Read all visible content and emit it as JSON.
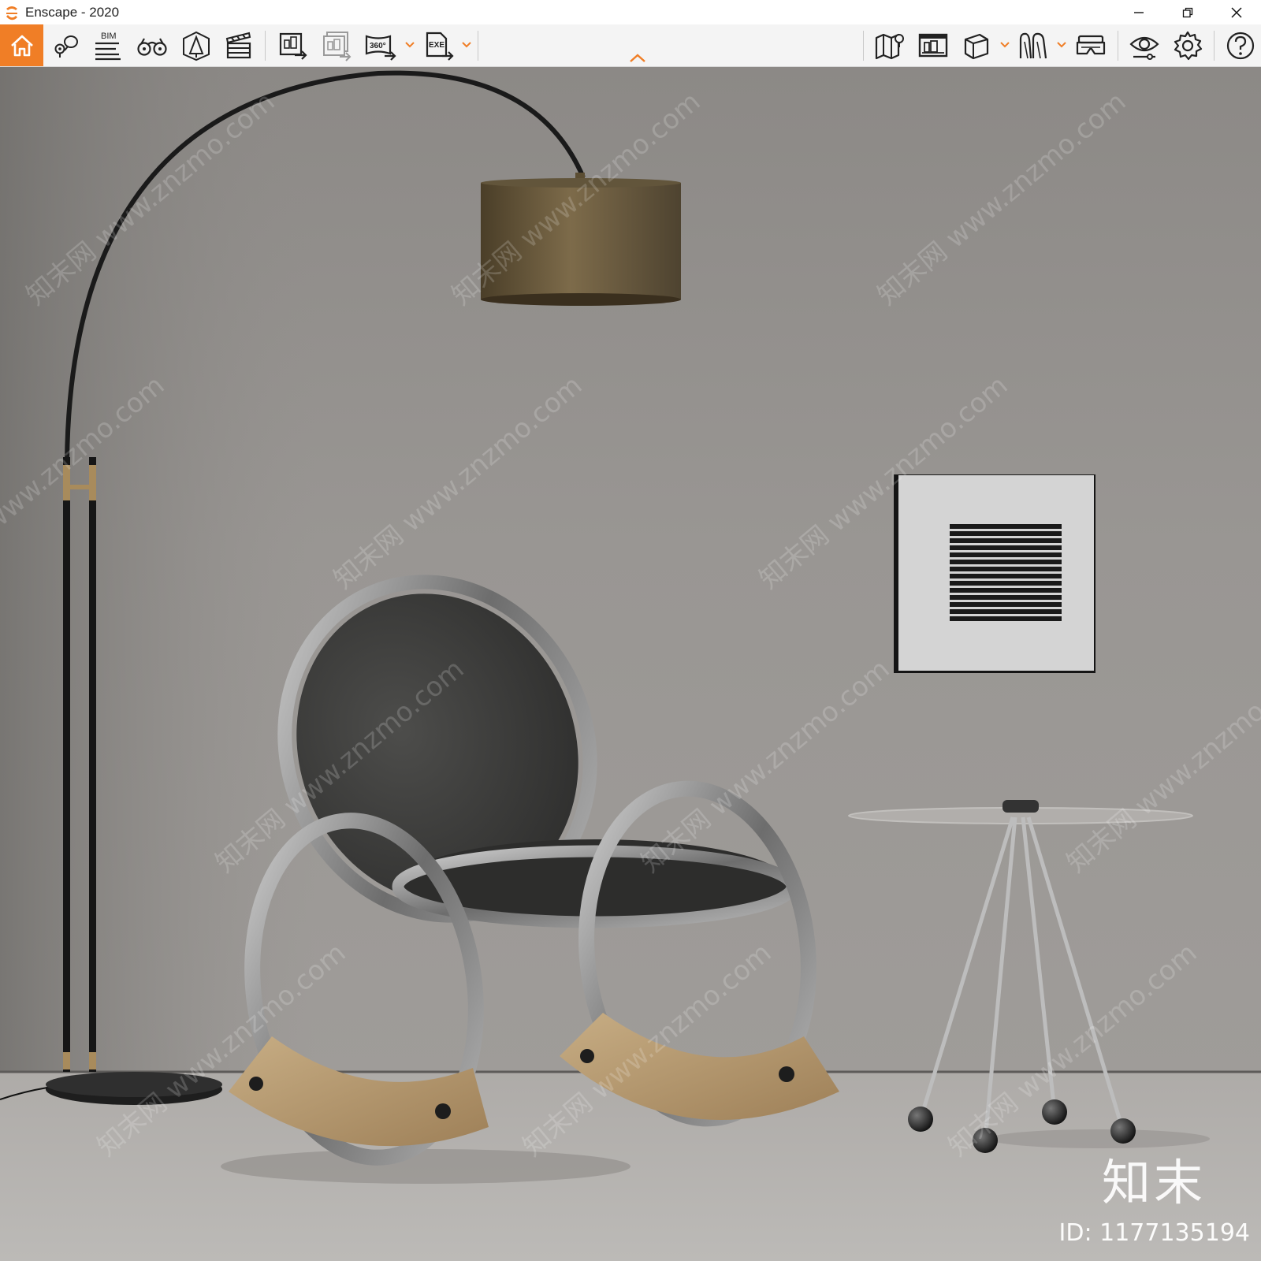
{
  "window": {
    "title": "Enscape - 2020",
    "controls": {
      "minimize": "minimize-icon",
      "restore": "restore-icon",
      "close": "close-icon"
    }
  },
  "toolbar": {
    "left_buttons": [
      {
        "name": "home-icon",
        "label": ""
      },
      {
        "name": "views-icon",
        "label": ""
      },
      {
        "name": "bim-icon",
        "label": "BIM"
      },
      {
        "name": "binoculars-icon",
        "label": ""
      },
      {
        "name": "asset-library-icon",
        "label": ""
      },
      {
        "name": "clapperboard-icon",
        "label": ""
      },
      {
        "name": "screenshot-export-icon",
        "label": ""
      },
      {
        "name": "batch-export-icon",
        "label": ""
      },
      {
        "name": "panorama-360-icon",
        "label": "360°"
      },
      {
        "name": "exe-export-icon",
        "label": "EXE"
      }
    ],
    "right_buttons": [
      {
        "name": "map-icon"
      },
      {
        "name": "render-window-icon"
      },
      {
        "name": "cube-icon"
      },
      {
        "name": "walk-icon"
      },
      {
        "name": "vr-headset-icon"
      },
      {
        "name": "eye-icon"
      },
      {
        "name": "settings-gear-icon"
      },
      {
        "name": "help-icon"
      }
    ],
    "accent_color": "#f07e26"
  },
  "viewport": {
    "watermark_text": "知末网 www.znzmo.com",
    "brand_watermark": "知末",
    "id_text": "ID: 1177135194"
  }
}
